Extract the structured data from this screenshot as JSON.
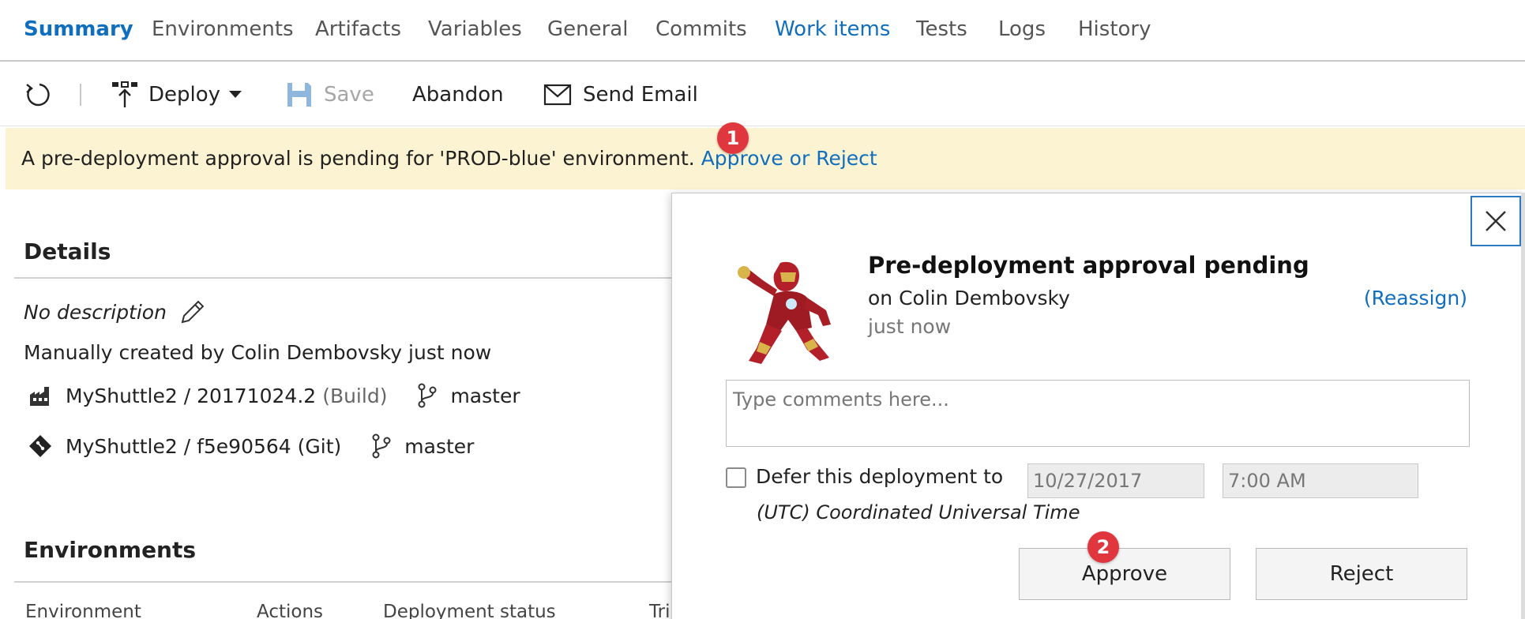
{
  "tabs": [
    {
      "label": "Summary"
    },
    {
      "label": "Environments"
    },
    {
      "label": "Artifacts"
    },
    {
      "label": "Variables"
    },
    {
      "label": "General"
    },
    {
      "label": "Commits"
    },
    {
      "label": "Work items"
    },
    {
      "label": "Tests"
    },
    {
      "label": "Logs"
    },
    {
      "label": "History"
    }
  ],
  "toolbar": {
    "deploy_label": "Deploy",
    "save_label": "Save",
    "abandon_label": "Abandon",
    "email_label": "Send Email"
  },
  "banner": {
    "text": "A pre-deployment approval is pending for 'PROD-blue' environment.",
    "link": "Approve or Reject"
  },
  "badges": {
    "one": "1",
    "two": "2"
  },
  "details": {
    "title": "Details",
    "description": "No description",
    "created_by": "Manually created by Colin Dembovsky just now",
    "artifacts": [
      {
        "name": "MyShuttle2 / 20171024.2",
        "type": "(Build)",
        "branch": "master"
      },
      {
        "name": "MyShuttle2 / f5e90564 (Git)",
        "branch": "master"
      }
    ]
  },
  "environments": {
    "title": "Environments",
    "columns": [
      "Environment",
      "Actions",
      "Deployment status",
      "Tri"
    ]
  },
  "dialog": {
    "title": "Pre-deployment approval pending",
    "subtitle": "on Colin Dembovsky",
    "time": "just now",
    "reassign": "(Reassign)",
    "comments_placeholder": "Type comments here...",
    "defer_label": "Defer this deployment to",
    "defer_date": "10/27/2017",
    "defer_time": "7:00 AM",
    "timezone": "(UTC) Coordinated Universal Time",
    "approve_label": "Approve",
    "reject_label": "Reject"
  },
  "colors": {
    "accent": "#106ebe",
    "banner_bg": "#fcf3d2",
    "badge": "#e0373f"
  }
}
